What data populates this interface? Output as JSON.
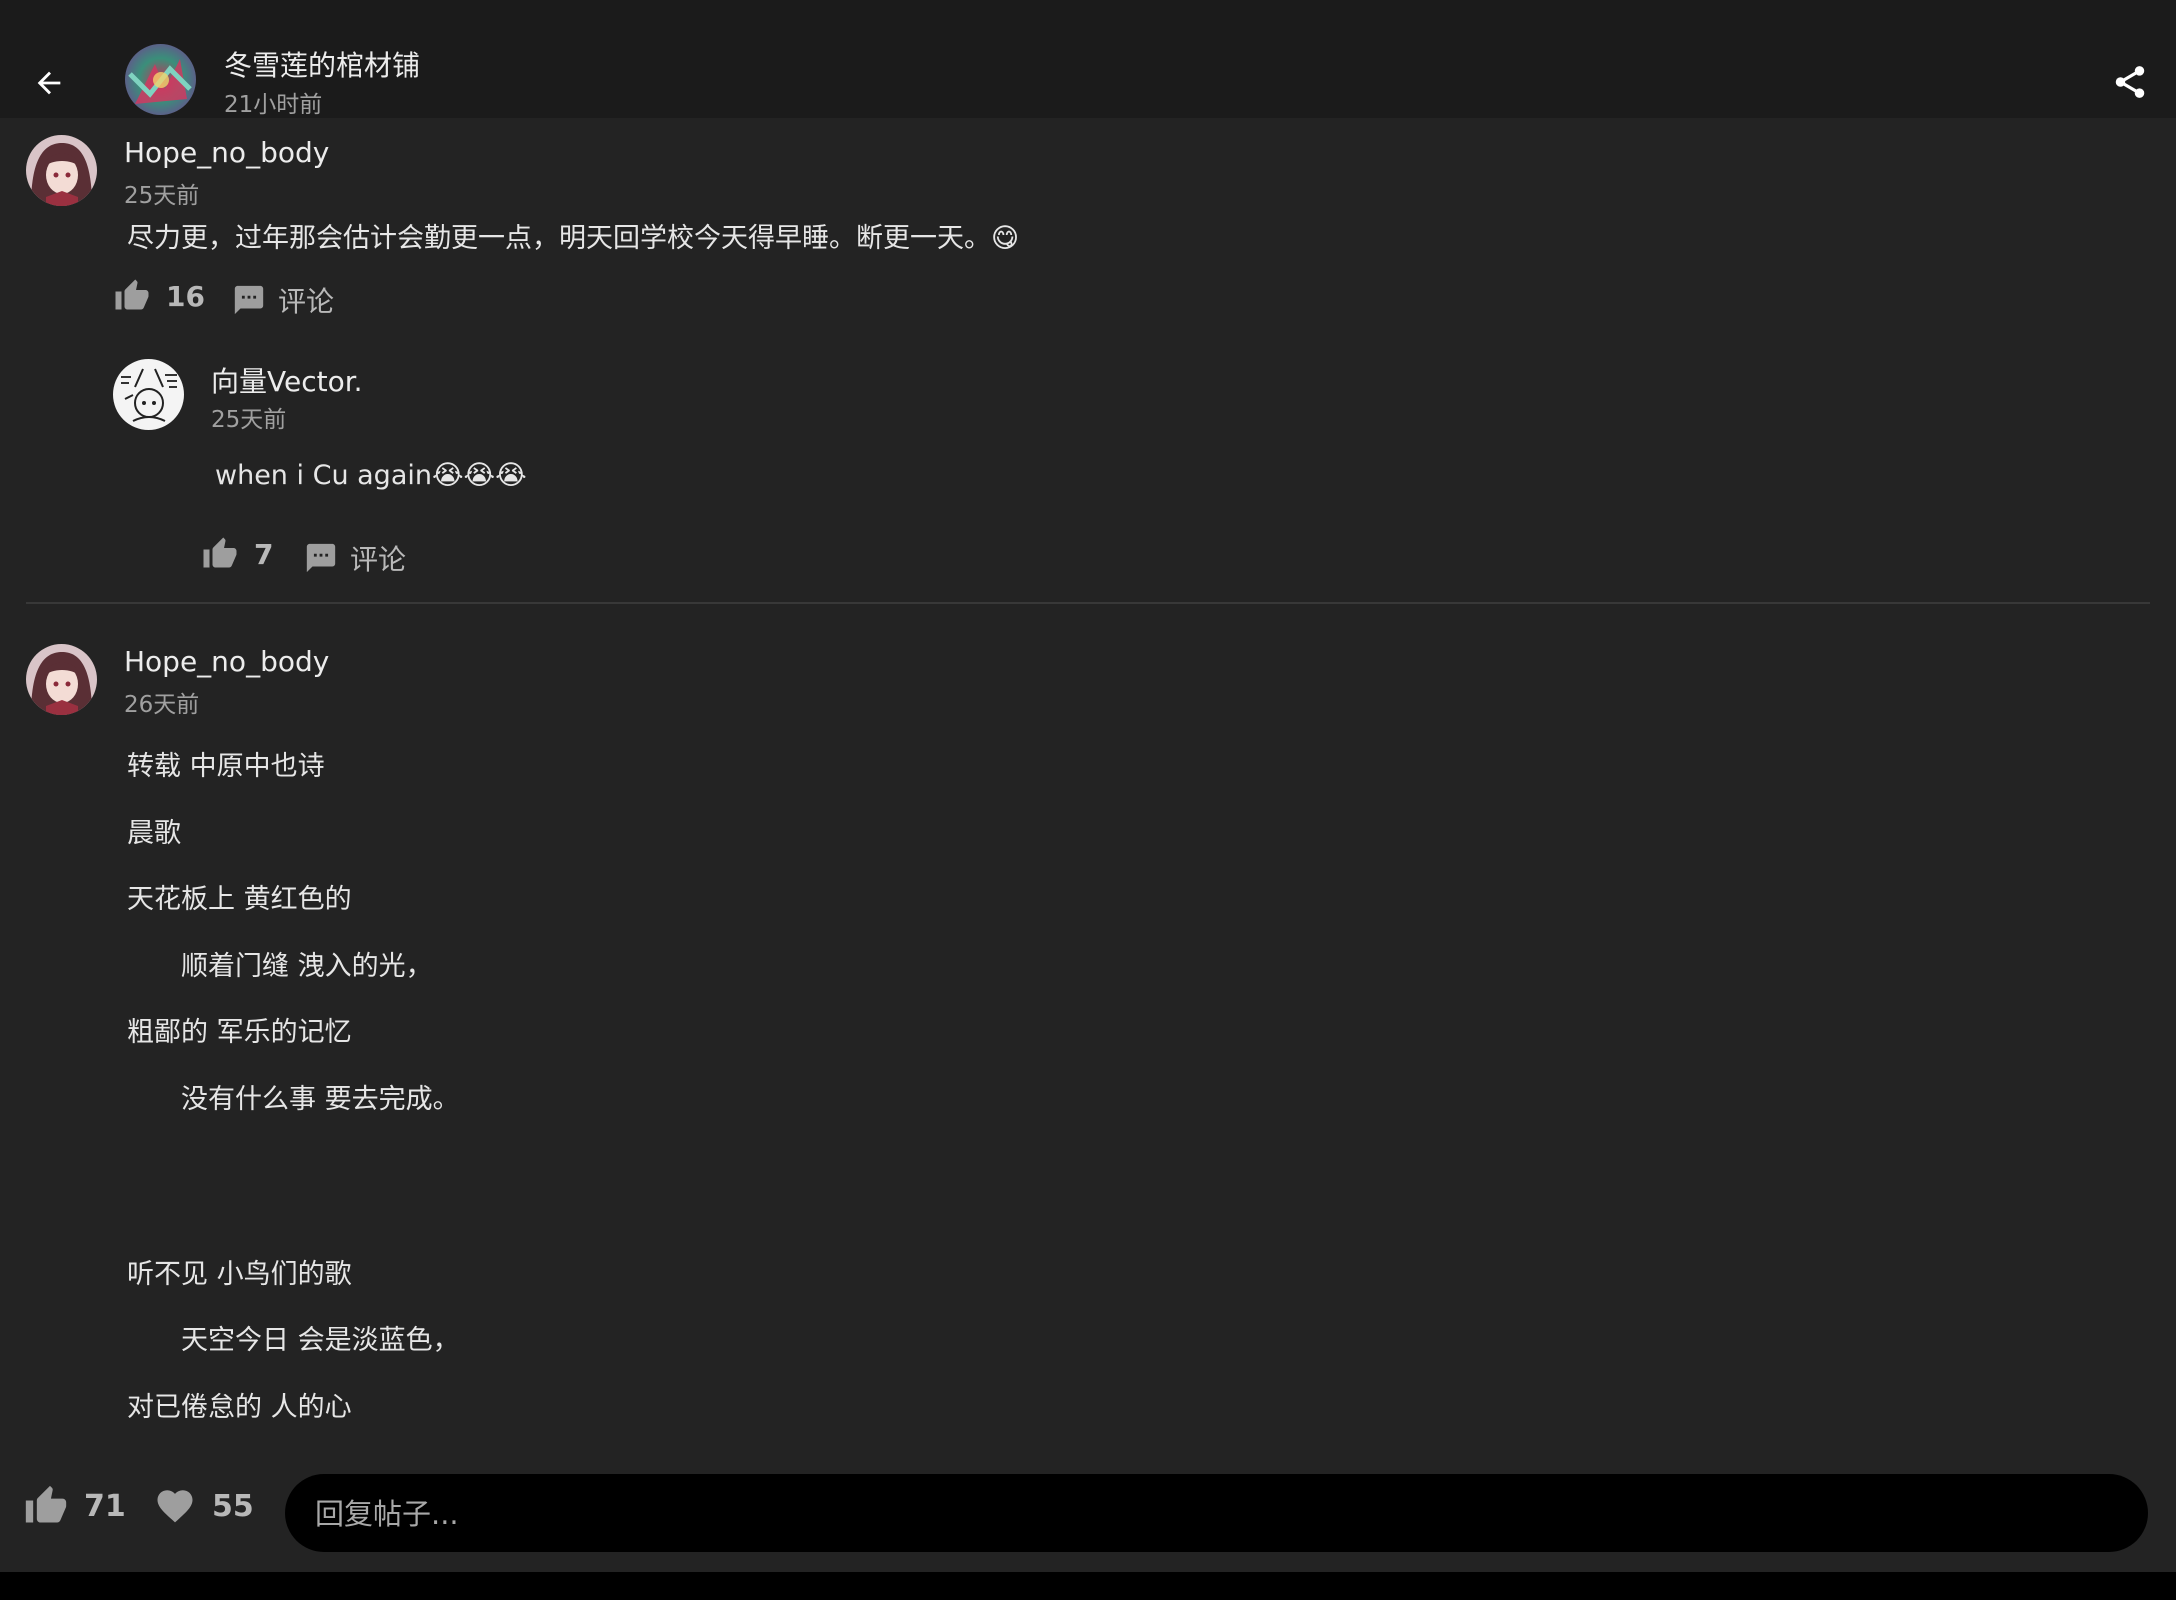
{
  "header": {
    "title": "冬雪莲的棺材铺",
    "time": "21小时前"
  },
  "comments": [
    {
      "username": "Hope_no_body",
      "time": "25天前",
      "text": "尽力更，过年那会估计会勤更一点，明天回学校今天得早睡。断更一天。😋",
      "likes": "16",
      "comment_label": "评论",
      "reply": {
        "username": "向量Vector.",
        "time": "25天前",
        "text": "when i Cu again😭😭😭",
        "likes": "7",
        "comment_label": "评论"
      }
    },
    {
      "username": "Hope_no_body",
      "time": "26天前",
      "lines": [
        "转载 中原中也诗",
        "晨歌",
        "天花板上 黄红色的",
        "顺着门缝 洩入的光，",
        "粗鄙的 军乐的记忆",
        "没有什么事 要去完成。",
        "听不见 小鸟们的歌",
        "天空今日 会是淡蓝色，",
        "对已倦怠的 人的心"
      ]
    }
  ],
  "bottom": {
    "likes": "71",
    "favorites": "55",
    "reply_placeholder": "回复帖子..."
  }
}
